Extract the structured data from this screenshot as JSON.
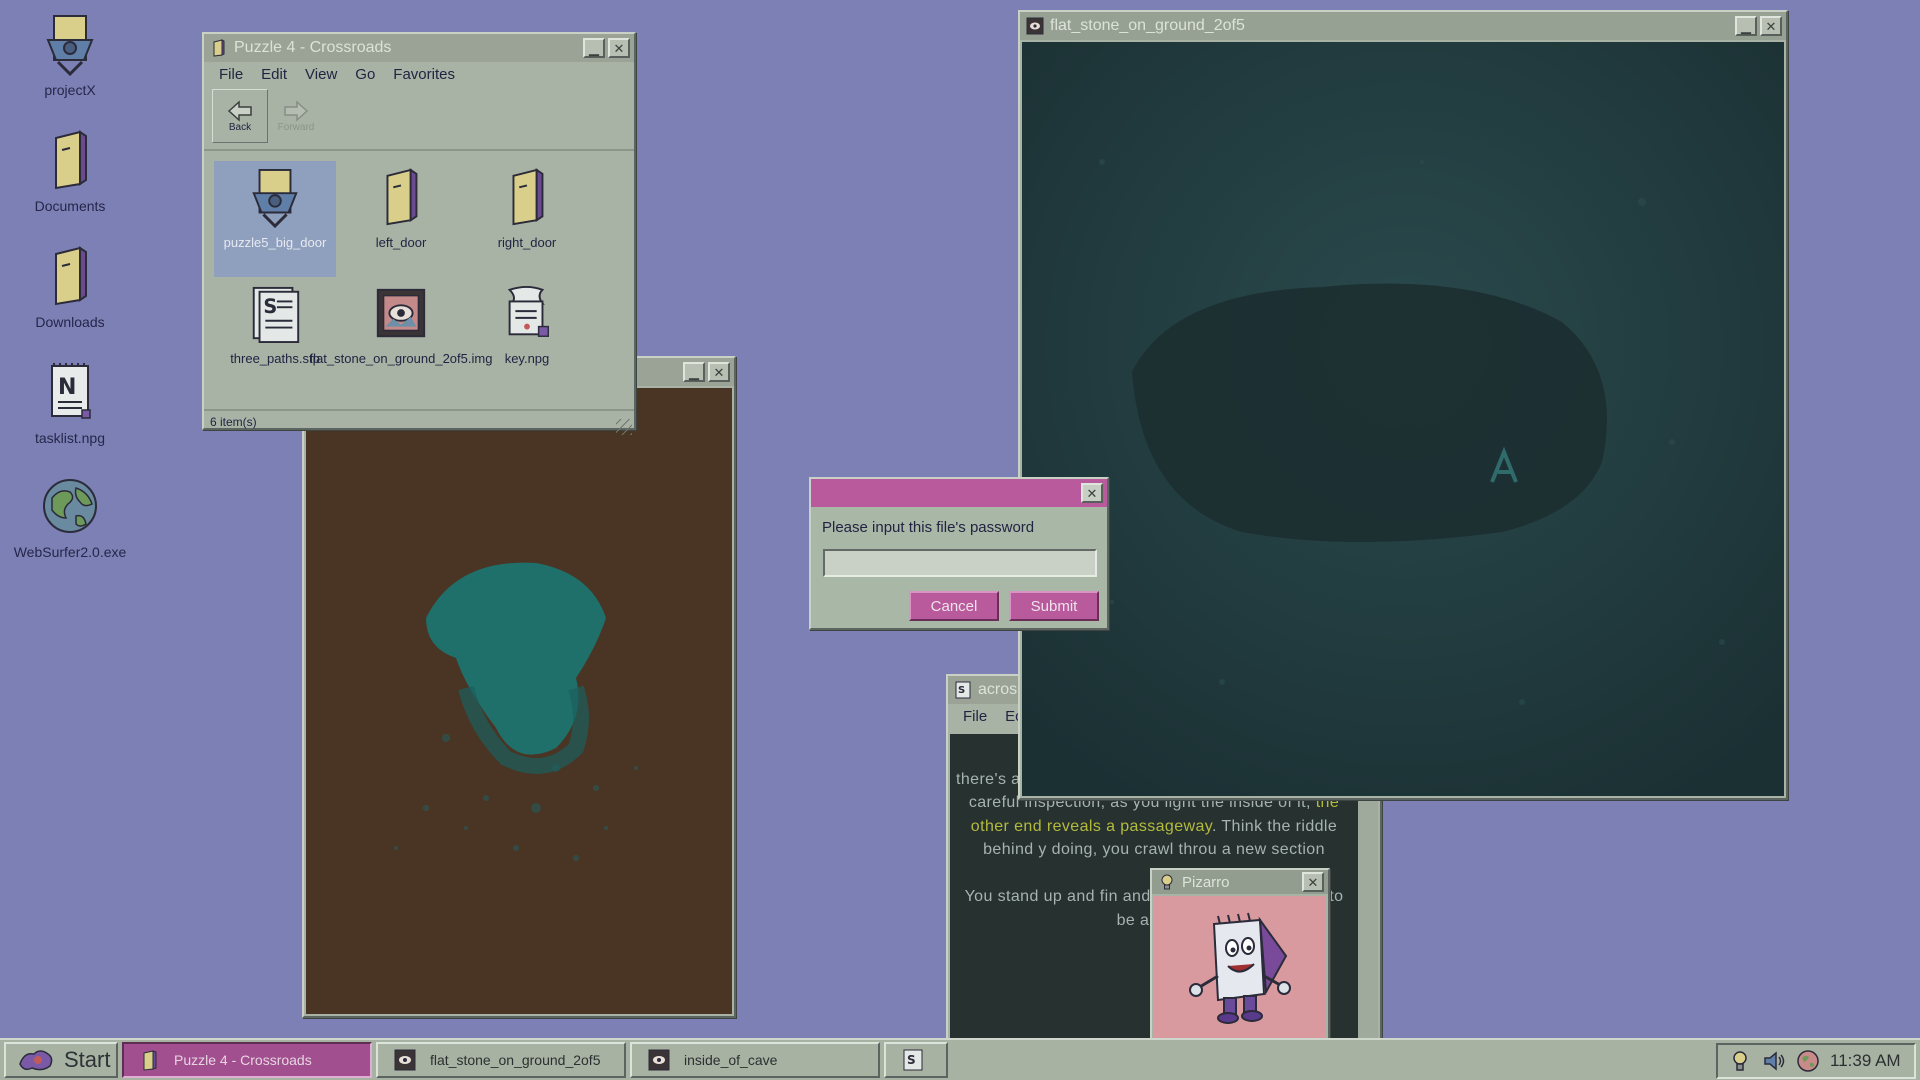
{
  "desktop": {
    "icons": [
      {
        "label": "projectX",
        "icon": "vault-door-icon"
      },
      {
        "label": "Documents",
        "icon": "folder-door-icon"
      },
      {
        "label": "Downloads",
        "icon": "folder-door-icon"
      },
      {
        "label": "tasklist.npg",
        "icon": "notepad-icon"
      },
      {
        "label": "WebSurfer2.0.exe",
        "icon": "globe-icon"
      }
    ]
  },
  "explorer": {
    "title": "Puzzle 4 - Crossroads",
    "menu": [
      "File",
      "Edit",
      "View",
      "Go",
      "Favorites"
    ],
    "toolbar": {
      "back": "Back",
      "forward": "Forward"
    },
    "files": [
      {
        "label": "puzzle5_big_door",
        "icon": "vault-door-icon",
        "selected": true
      },
      {
        "label": "left_door",
        "icon": "folder-door-icon"
      },
      {
        "label": "right_door",
        "icon": "folder-door-icon"
      },
      {
        "label": "three_paths.stp",
        "icon": "script-document-icon"
      },
      {
        "label": "flat_stone_on_ground_2of5.img",
        "icon": "image-file-icon"
      },
      {
        "label": "key.npg",
        "icon": "note-file-icon"
      }
    ],
    "status": "6 item(s)"
  },
  "image_window": {
    "title": "flat_stone_on_ground_2of5"
  },
  "text_window": {
    "title": "acros",
    "menu": [
      "File",
      "Ec"
    ],
    "paragraph1_pre": "Be\nthere's a hollow tree trunk laying on the ground. After careful inspection, as you light the inside of it,",
    "paragraph1_highlight": "the other end reveals a passageway",
    "paragraph1_post": ". Think the riddle behind y doing, you crawl throu a new section",
    "paragraph2": "You stand up and fin and closed space w seems to be a dead"
  },
  "pizarro": {
    "title": "Pizarro"
  },
  "dialog": {
    "prompt": "Please input this file's password",
    "input_value": "",
    "cancel": "Cancel",
    "submit": "Submit"
  },
  "taskbar": {
    "start": "Start",
    "tasks": [
      {
        "label": "Puzzle 4 - Crossroads",
        "active": true
      },
      {
        "label": "flat_stone_on_ground_2of5"
      },
      {
        "label": "inside_of_cave"
      }
    ],
    "clock": "11:39 AM"
  },
  "colors": {
    "desktop": "#7d80b4",
    "dialog_accent": "#b85a9b",
    "highlight_text": "#b4bb3c"
  }
}
